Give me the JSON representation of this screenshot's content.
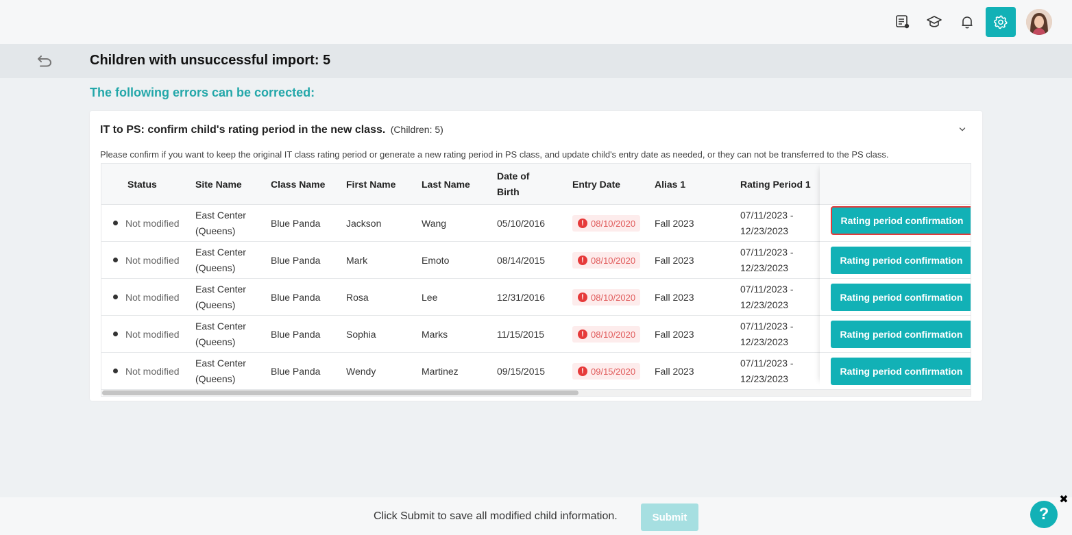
{
  "header": {
    "icons": [
      "feedback-icon",
      "graduation-cap-icon",
      "bell-icon",
      "gear-icon",
      "avatar"
    ],
    "accent_color": "#12b1b6"
  },
  "page": {
    "title": "Children with unsuccessful import: 5",
    "section_heading": "The following errors can be corrected:"
  },
  "card": {
    "title": "IT to PS: confirm child's rating period in the new class.",
    "count": "(Children: 5)",
    "description": "Please confirm if you want to keep the original IT class rating period or generate a new rating period in PS class, and update child's entry date as needed, or they can not be transferred to the PS class."
  },
  "table": {
    "columns": [
      "Status",
      "Site Name",
      "Class Name",
      "First Name",
      "Last Name",
      "Date of Birth",
      "Entry Date",
      "Alias 1",
      "Rating Period 1"
    ],
    "rows": [
      {
        "status": "Not modified",
        "site": "East Center (Queens)",
        "class": "Blue Panda",
        "first": "Jackson",
        "last": "Wang",
        "dob": "05/10/2016",
        "entry": "08/10/2020",
        "alias": "Fall 2023",
        "rating": "07/11/2023 - 12/23/2023",
        "action": "Rating period confirmation"
      },
      {
        "status": "Not modified",
        "site": "East Center (Queens)",
        "class": "Blue Panda",
        "first": "Mark",
        "last": "Emoto",
        "dob": "08/14/2015",
        "entry": "08/10/2020",
        "alias": "Fall 2023",
        "rating": "07/11/2023 - 12/23/2023",
        "action": "Rating period confirmation"
      },
      {
        "status": "Not modified",
        "site": "East Center (Queens)",
        "class": "Blue Panda",
        "first": "Rosa",
        "last": "Lee",
        "dob": "12/31/2016",
        "entry": "08/10/2020",
        "alias": "Fall 2023",
        "rating": "07/11/2023 - 12/23/2023",
        "action": "Rating period confirmation"
      },
      {
        "status": "Not modified",
        "site": "East Center (Queens)",
        "class": "Blue Panda",
        "first": "Sophia",
        "last": "Marks",
        "dob": "11/15/2015",
        "entry": "08/10/2020",
        "alias": "Fall 2023",
        "rating": "07/11/2023 - 12/23/2023",
        "action": "Rating period confirmation"
      },
      {
        "status": "Not modified",
        "site": "East Center (Queens)",
        "class": "Blue Panda",
        "first": "Wendy",
        "last": "Martinez",
        "dob": "09/15/2015",
        "entry": "09/15/2020",
        "alias": "Fall 2023",
        "rating": "07/11/2023 - 12/23/2023",
        "action": "Rating period confirmation"
      }
    ]
  },
  "footer": {
    "message": "Click Submit to save all modified child information.",
    "submit_label": "Submit",
    "help_label": "?",
    "close_label": "✖"
  }
}
